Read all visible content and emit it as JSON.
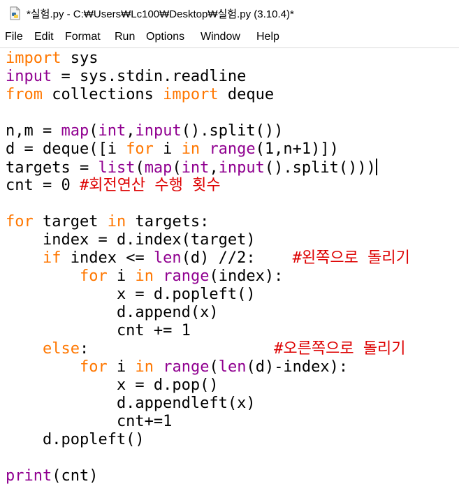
{
  "window": {
    "title": "*실험.py - C:₩Users₩Lc100₩Desktop₩실험.py (3.10.4)*",
    "app_icon": "python-file-icon"
  },
  "menu": {
    "items": [
      "File",
      "Edit",
      "Format",
      "Run",
      "Options",
      "Window",
      "Help"
    ]
  },
  "colors": {
    "keyword": "#ff7700",
    "builtin": "#900090",
    "comment": "#dd0000",
    "text": "#000000"
  },
  "editor": {
    "cursor_line": 6,
    "lines": [
      [
        [
          "kw",
          "import"
        ],
        [
          "tx",
          " sys"
        ]
      ],
      [
        [
          "bi",
          "input"
        ],
        [
          "tx",
          " = sys.stdin.readline"
        ]
      ],
      [
        [
          "kw",
          "from"
        ],
        [
          "tx",
          " collections "
        ],
        [
          "kw",
          "import"
        ],
        [
          "tx",
          " deque"
        ]
      ],
      [],
      [
        [
          "tx",
          "n,m = "
        ],
        [
          "bi",
          "map"
        ],
        [
          "tx",
          "("
        ],
        [
          "bi",
          "int"
        ],
        [
          "tx",
          ","
        ],
        [
          "bi",
          "input"
        ],
        [
          "tx",
          "().split())"
        ]
      ],
      [
        [
          "tx",
          "d = deque([i "
        ],
        [
          "kw",
          "for"
        ],
        [
          "tx",
          " i "
        ],
        [
          "kw",
          "in"
        ],
        [
          "tx",
          " "
        ],
        [
          "bi",
          "range"
        ],
        [
          "tx",
          "(1,n+1)])"
        ]
      ],
      [
        [
          "tx",
          "targets = "
        ],
        [
          "bi",
          "list"
        ],
        [
          "tx",
          "("
        ],
        [
          "bi",
          "map"
        ],
        [
          "tx",
          "("
        ],
        [
          "bi",
          "int"
        ],
        [
          "tx",
          ","
        ],
        [
          "bi",
          "input"
        ],
        [
          "tx",
          "().split()))"
        ]
      ],
      [
        [
          "tx",
          "cnt = 0 "
        ],
        [
          "cm",
          "#회전연산 수행 횟수"
        ]
      ],
      [],
      [
        [
          "kw",
          "for"
        ],
        [
          "tx",
          " target "
        ],
        [
          "kw",
          "in"
        ],
        [
          "tx",
          " targets:"
        ]
      ],
      [
        [
          "tx",
          "    index = d.index(target)"
        ]
      ],
      [
        [
          "tx",
          "    "
        ],
        [
          "kw",
          "if"
        ],
        [
          "tx",
          " index <= "
        ],
        [
          "bi",
          "len"
        ],
        [
          "tx",
          "(d) //2:    "
        ],
        [
          "cm",
          "#왼쪽으로 돌리기"
        ]
      ],
      [
        [
          "tx",
          "        "
        ],
        [
          "kw",
          "for"
        ],
        [
          "tx",
          " i "
        ],
        [
          "kw",
          "in"
        ],
        [
          "tx",
          " "
        ],
        [
          "bi",
          "range"
        ],
        [
          "tx",
          "(index):"
        ]
      ],
      [
        [
          "tx",
          "            x = d.popleft()"
        ]
      ],
      [
        [
          "tx",
          "            d.append(x)"
        ]
      ],
      [
        [
          "tx",
          "            cnt += 1"
        ]
      ],
      [
        [
          "tx",
          "    "
        ],
        [
          "kw",
          "else"
        ],
        [
          "tx",
          ":                    "
        ],
        [
          "cm",
          "#오른쪽으로 돌리기"
        ]
      ],
      [
        [
          "tx",
          "        "
        ],
        [
          "kw",
          "for"
        ],
        [
          "tx",
          " i "
        ],
        [
          "kw",
          "in"
        ],
        [
          "tx",
          " "
        ],
        [
          "bi",
          "range"
        ],
        [
          "tx",
          "("
        ],
        [
          "bi",
          "len"
        ],
        [
          "tx",
          "(d)-index):"
        ]
      ],
      [
        [
          "tx",
          "            x = d.pop()"
        ]
      ],
      [
        [
          "tx",
          "            d.appendleft(x)"
        ]
      ],
      [
        [
          "tx",
          "            cnt+=1"
        ]
      ],
      [
        [
          "tx",
          "    d.popleft()"
        ]
      ],
      [],
      [
        [
          "bi",
          "print"
        ],
        [
          "tx",
          "(cnt)"
        ]
      ]
    ]
  }
}
